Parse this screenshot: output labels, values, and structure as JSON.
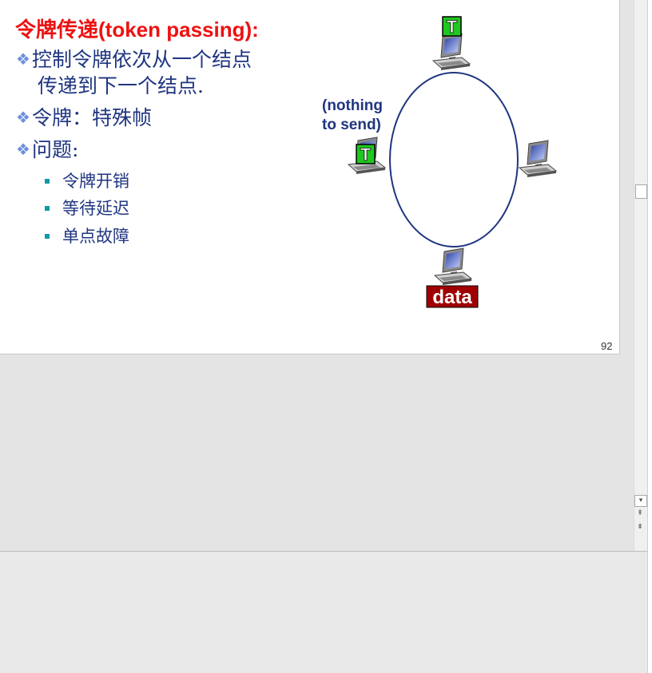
{
  "slide": {
    "title_cn": "令牌传递",
    "title_en": "(token passing):",
    "bullets": [
      {
        "line1": "控制令牌依次从一个结点",
        "line2": "传递到下一个结点."
      },
      {
        "line1": "令牌：特殊帧"
      },
      {
        "line1": "问题:"
      }
    ],
    "sub_bullets": [
      "令牌开销",
      "等待延迟",
      "单点故障"
    ],
    "page_number": "92"
  },
  "diagram": {
    "nothing_line1": "(nothing",
    "nothing_line2": "to send)",
    "token_letter": "T",
    "data_label": "data",
    "colors": {
      "ring": "#1f3580",
      "token_bg": "#1ec81e",
      "data_bg": "#a00000"
    }
  },
  "scrollbar": {
    "down_arrow": "▾",
    "prev_slide": "⇞",
    "next_slide": "⇟"
  }
}
